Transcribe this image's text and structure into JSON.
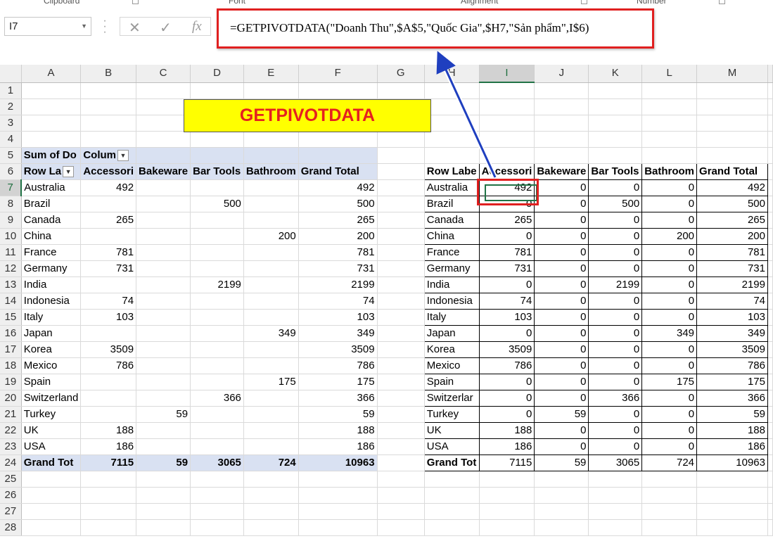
{
  "ribbon": [
    "Clipboard",
    "Font",
    "Alignment",
    "Number"
  ],
  "name_box": "I7",
  "formula_icons": [
    "cancel-icon",
    "enter-icon",
    "function-icon"
  ],
  "formula_buttons": [
    "✕",
    "✓",
    "fx"
  ],
  "formula": "=GETPIVOTDATA(\"Doanh Thu\",$A$5,\"Quốc Gia\",$H7,\"Sản phẩm\",I$6)",
  "columns": [
    "A",
    "B",
    "C",
    "D",
    "E",
    "F",
    "G",
    "H",
    "I",
    "J",
    "K",
    "L",
    "M"
  ],
  "rows": [
    "1",
    "2",
    "3",
    "4",
    "5",
    "6",
    "7",
    "8",
    "9",
    "10",
    "11",
    "12",
    "13",
    "14",
    "15",
    "16",
    "17",
    "18",
    "19",
    "20",
    "21",
    "22",
    "23",
    "24",
    "25",
    "26",
    "27",
    "28"
  ],
  "title": "GETPIVOTDATA",
  "pivot": {
    "values_label": "Sum of Do",
    "columns_label": "Colum",
    "row_labels": "Row La",
    "headers": [
      "Accessori",
      "Bakeware",
      "Bar Tools",
      "Bathroom",
      "Grand Total"
    ],
    "rows": [
      {
        "country": "Australia",
        "acc": "492",
        "bak": "",
        "bar": "",
        "bath": "",
        "total": "492"
      },
      {
        "country": "Brazil",
        "acc": "",
        "bak": "",
        "bar": "500",
        "bath": "",
        "total": "500"
      },
      {
        "country": "Canada",
        "acc": "265",
        "bak": "",
        "bar": "",
        "bath": "",
        "total": "265"
      },
      {
        "country": "China",
        "acc": "",
        "bak": "",
        "bar": "",
        "bath": "200",
        "total": "200"
      },
      {
        "country": "France",
        "acc": "781",
        "bak": "",
        "bar": "",
        "bath": "",
        "total": "781"
      },
      {
        "country": "Germany",
        "acc": "731",
        "bak": "",
        "bar": "",
        "bath": "",
        "total": "731"
      },
      {
        "country": "India",
        "acc": "",
        "bak": "",
        "bar": "2199",
        "bath": "",
        "total": "2199"
      },
      {
        "country": "Indonesia",
        "acc": "74",
        "bak": "",
        "bar": "",
        "bath": "",
        "total": "74"
      },
      {
        "country": "Italy",
        "acc": "103",
        "bak": "",
        "bar": "",
        "bath": "",
        "total": "103"
      },
      {
        "country": "Japan",
        "acc": "",
        "bak": "",
        "bar": "",
        "bath": "349",
        "total": "349"
      },
      {
        "country": "Korea",
        "acc": "3509",
        "bak": "",
        "bar": "",
        "bath": "",
        "total": "3509"
      },
      {
        "country": "Mexico",
        "acc": "786",
        "bak": "",
        "bar": "",
        "bath": "",
        "total": "786"
      },
      {
        "country": "Spain",
        "acc": "",
        "bak": "",
        "bar": "",
        "bath": "175",
        "total": "175"
      },
      {
        "country": "Switzerland",
        "acc": "",
        "bak": "",
        "bar": "366",
        "bath": "",
        "total": "366"
      },
      {
        "country": "Turkey",
        "acc": "",
        "bak": "59",
        "bar": "",
        "bath": "",
        "total": "59"
      },
      {
        "country": "UK",
        "acc": "188",
        "bak": "",
        "bar": "",
        "bath": "",
        "total": "188"
      },
      {
        "country": "USA",
        "acc": "186",
        "bak": "",
        "bar": "",
        "bath": "",
        "total": "186"
      }
    ],
    "grand": {
      "label": "Grand Tot",
      "acc": "7115",
      "bak": "59",
      "bar": "3065",
      "bath": "724",
      "total": "10963"
    }
  },
  "table2": {
    "row_label_header": "Row Labe",
    "headers": [
      "Accessori",
      "Bakeware",
      "Bar Tools",
      "Bathroom",
      "Grand Total"
    ],
    "rows": [
      {
        "country": "Australia",
        "acc": "492",
        "bak": "0",
        "bar": "0",
        "bath": "0",
        "total": "492"
      },
      {
        "country": "Brazil",
        "acc": "0",
        "bak": "0",
        "bar": "500",
        "bath": "0",
        "total": "500"
      },
      {
        "country": "Canada",
        "acc": "265",
        "bak": "0",
        "bar": "0",
        "bath": "0",
        "total": "265"
      },
      {
        "country": "China",
        "acc": "0",
        "bak": "0",
        "bar": "0",
        "bath": "200",
        "total": "200"
      },
      {
        "country": "France",
        "acc": "781",
        "bak": "0",
        "bar": "0",
        "bath": "0",
        "total": "781"
      },
      {
        "country": "Germany",
        "acc": "731",
        "bak": "0",
        "bar": "0",
        "bath": "0",
        "total": "731"
      },
      {
        "country": "India",
        "acc": "0",
        "bak": "0",
        "bar": "2199",
        "bath": "0",
        "total": "2199"
      },
      {
        "country": "Indonesia",
        "acc": "74",
        "bak": "0",
        "bar": "0",
        "bath": "0",
        "total": "74"
      },
      {
        "country": "Italy",
        "acc": "103",
        "bak": "0",
        "bar": "0",
        "bath": "0",
        "total": "103"
      },
      {
        "country": "Japan",
        "acc": "0",
        "bak": "0",
        "bar": "0",
        "bath": "349",
        "total": "349"
      },
      {
        "country": "Korea",
        "acc": "3509",
        "bak": "0",
        "bar": "0",
        "bath": "0",
        "total": "3509"
      },
      {
        "country": "Mexico",
        "acc": "786",
        "bak": "0",
        "bar": "0",
        "bath": "0",
        "total": "786"
      },
      {
        "country": "Spain",
        "acc": "0",
        "bak": "0",
        "bar": "0",
        "bath": "175",
        "total": "175"
      },
      {
        "country": "Switzerlar",
        "acc": "0",
        "bak": "0",
        "bar": "366",
        "bath": "0",
        "total": "366"
      },
      {
        "country": "Turkey",
        "acc": "0",
        "bak": "59",
        "bar": "0",
        "bath": "0",
        "total": "59"
      },
      {
        "country": "UK",
        "acc": "188",
        "bak": "0",
        "bar": "0",
        "bath": "0",
        "total": "188"
      },
      {
        "country": "USA",
        "acc": "186",
        "bak": "0",
        "bar": "0",
        "bath": "0",
        "total": "186"
      }
    ],
    "grand": {
      "label": "Grand Tot",
      "acc": "7115",
      "bak": "59",
      "bar": "3065",
      "bath": "724",
      "total": "10963"
    }
  },
  "colors": {
    "pivot_header": "#d9e1f2",
    "title_bg": "#ffff00",
    "title_text": "#e52020",
    "highlight": "#e02020",
    "arrow": "#1f3fbf",
    "selection": "#217346"
  }
}
